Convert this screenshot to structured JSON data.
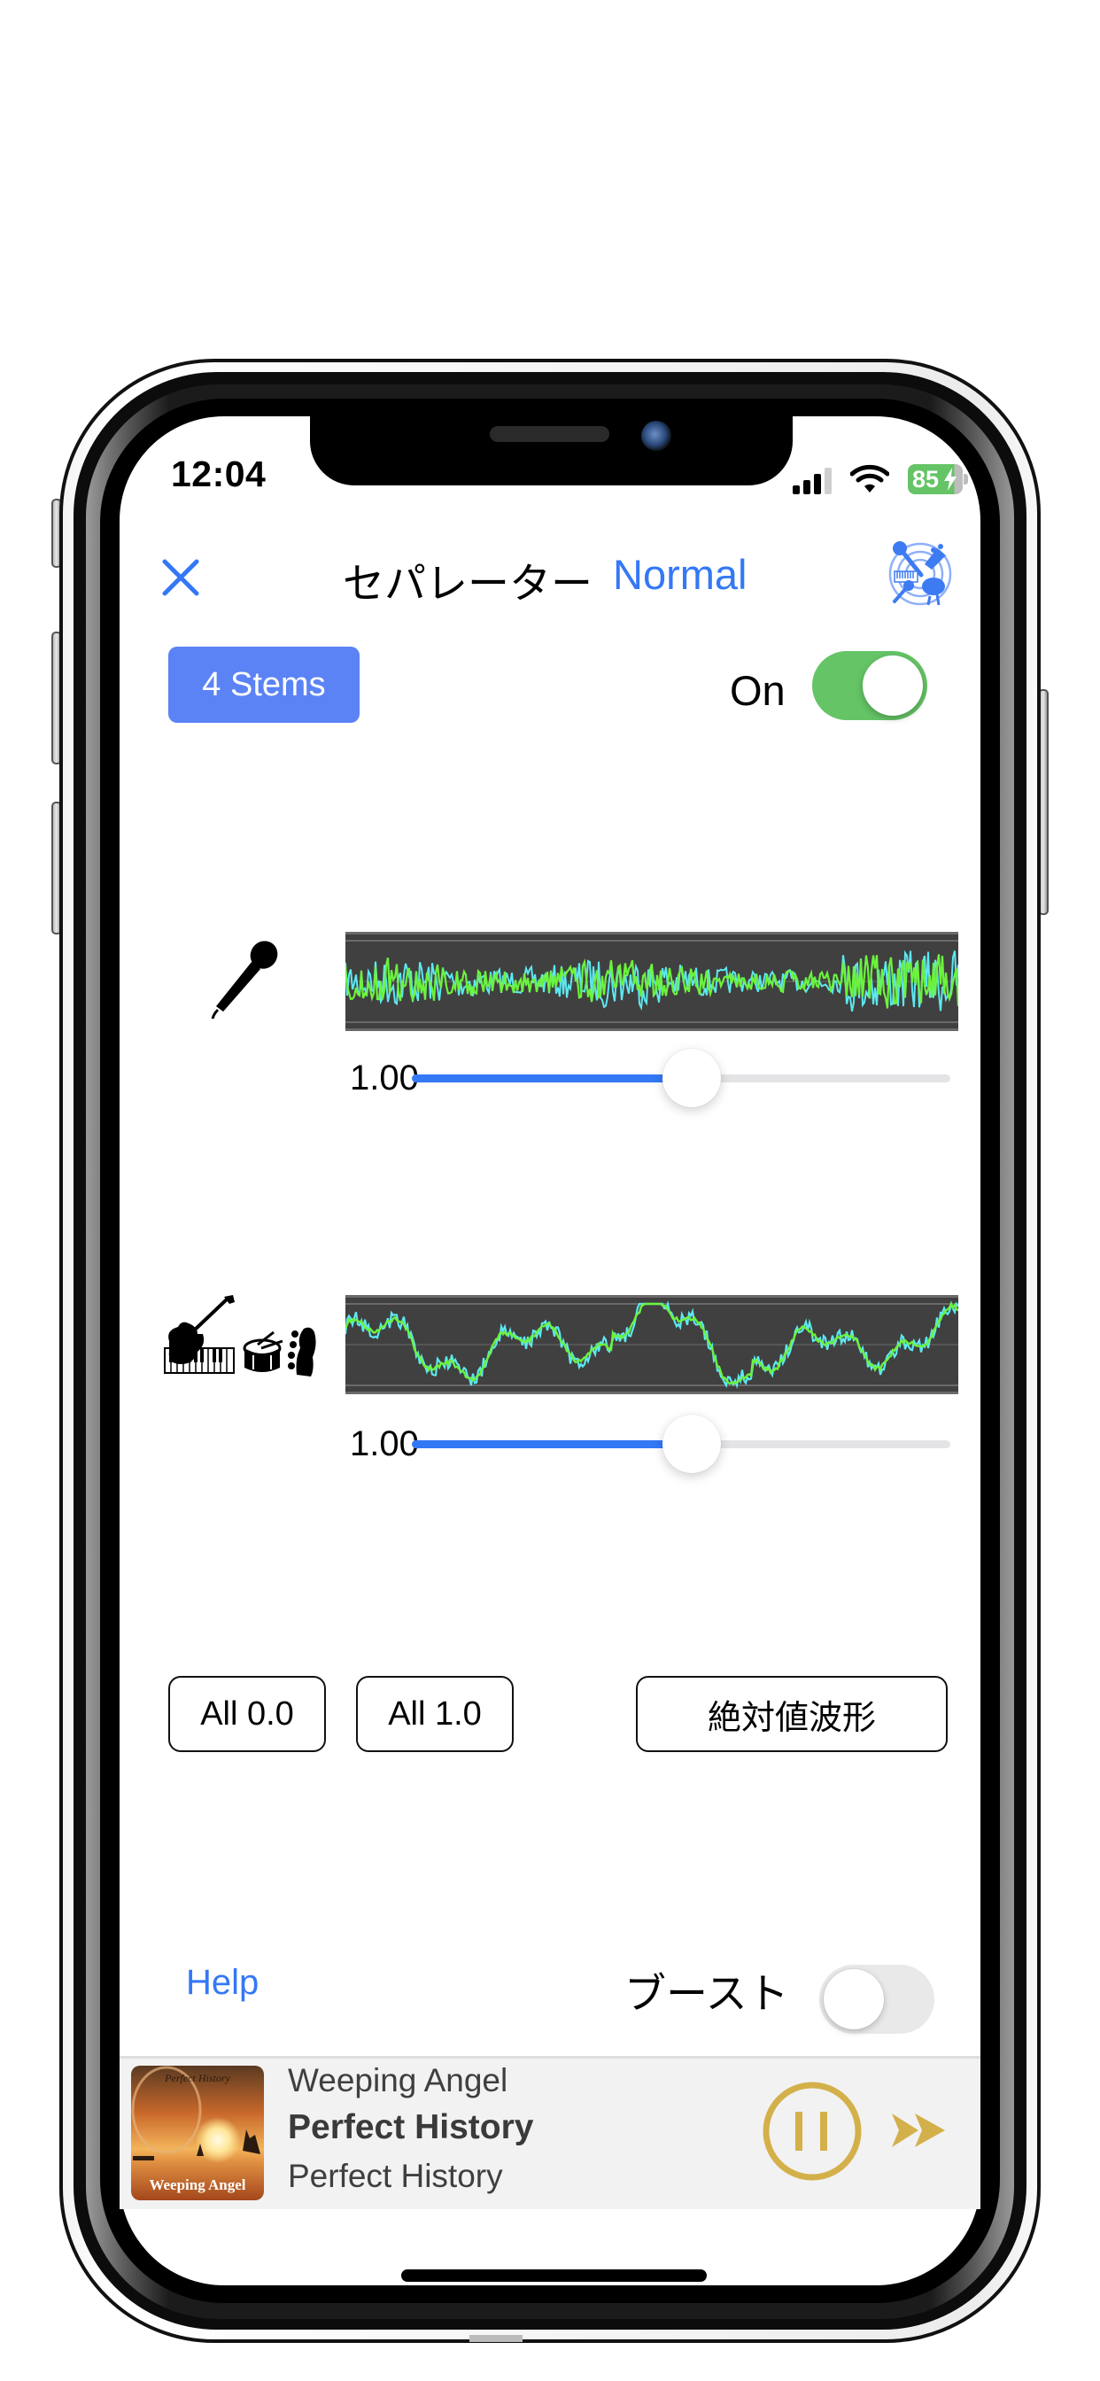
{
  "status_bar": {
    "time": "12:04",
    "battery_percent": "85",
    "signal_bars_active": 3,
    "icons": [
      "signal-icon",
      "wifi-icon",
      "battery-charging-icon"
    ]
  },
  "header": {
    "close_icon": "close-icon",
    "title": "セパレーター",
    "mode": "Normal",
    "app_icon": "instruments-separator-icon"
  },
  "controls": {
    "stems_button": "4 Stems",
    "separator_label": "On",
    "separator_on": true
  },
  "stems": [
    {
      "name": "vocals",
      "icon": "microphone-icon",
      "value_label": "1.00",
      "slider_fraction": 0.52
    },
    {
      "name": "instruments",
      "icon": "guitar-piano-drum-bass-icon",
      "value_label": "1.00",
      "slider_fraction": 0.52
    }
  ],
  "buttons": {
    "all_zero": "All 0.0",
    "all_one": "All 1.0",
    "abs_waveform": "絶対値波形"
  },
  "footer": {
    "help": "Help",
    "boost_label": "ブースト",
    "boost_on": false
  },
  "player": {
    "artist": "Weeping Angel",
    "title": "Perfect History",
    "album": "Perfect History",
    "album_art_text_top": "Perfect History",
    "album_art_text_bottom": "Weeping Angel",
    "state": "playing",
    "pause_icon": "pause-circle-icon",
    "forward_icon": "fast-forward-icon"
  },
  "colors": {
    "accent_blue": "#3478F6",
    "stems_button_blue": "#5B83F5",
    "toggle_green": "#65C466",
    "player_gold": "#D4B04A",
    "wave_green": "#6CF23E",
    "wave_cyan": "#5CE8F0",
    "wave_bg": "#404040"
  }
}
